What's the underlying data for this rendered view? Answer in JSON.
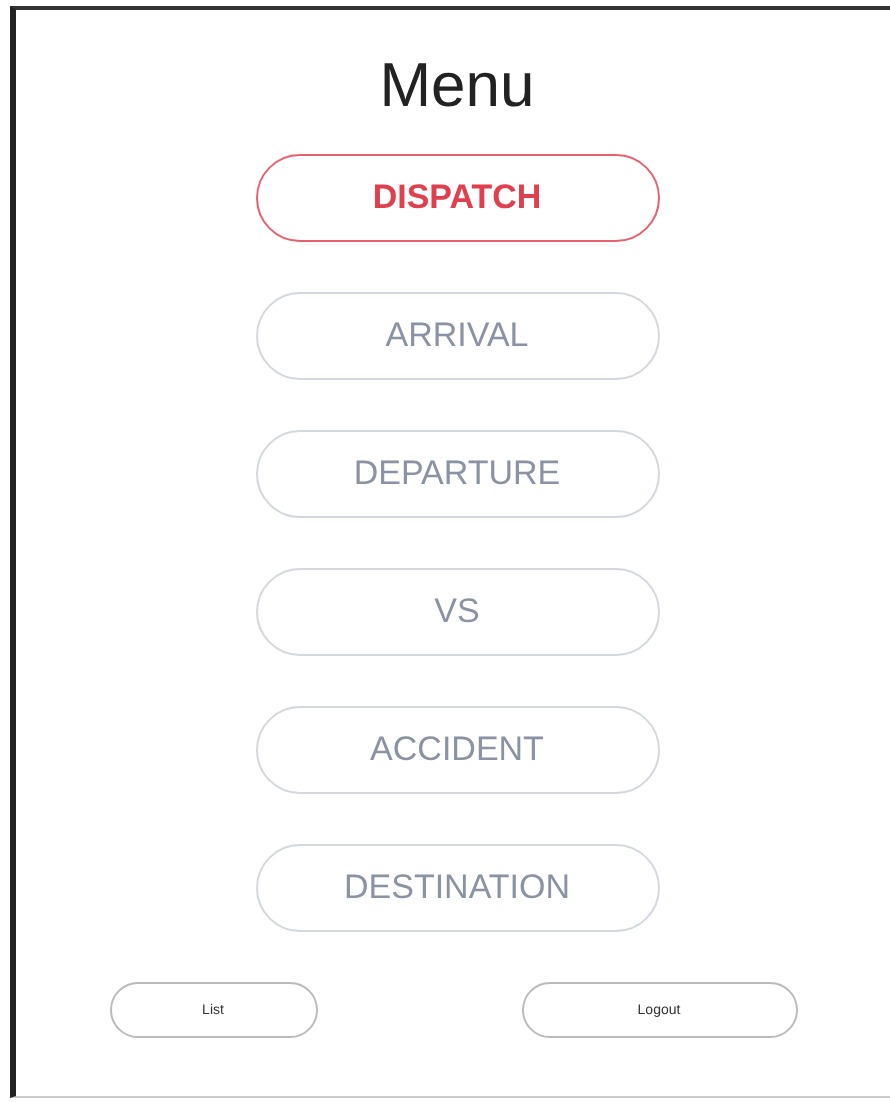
{
  "title": "Menu",
  "menu_items": [
    {
      "label": "DISPATCH",
      "selected": true
    },
    {
      "label": "ARRIVAL",
      "selected": false
    },
    {
      "label": "DEPARTURE",
      "selected": false
    },
    {
      "label": "VS",
      "selected": false
    },
    {
      "label": "ACCIDENT",
      "selected": false
    },
    {
      "label": "DESTINATION",
      "selected": false
    }
  ],
  "footer_buttons": [
    "List",
    "Logout"
  ]
}
